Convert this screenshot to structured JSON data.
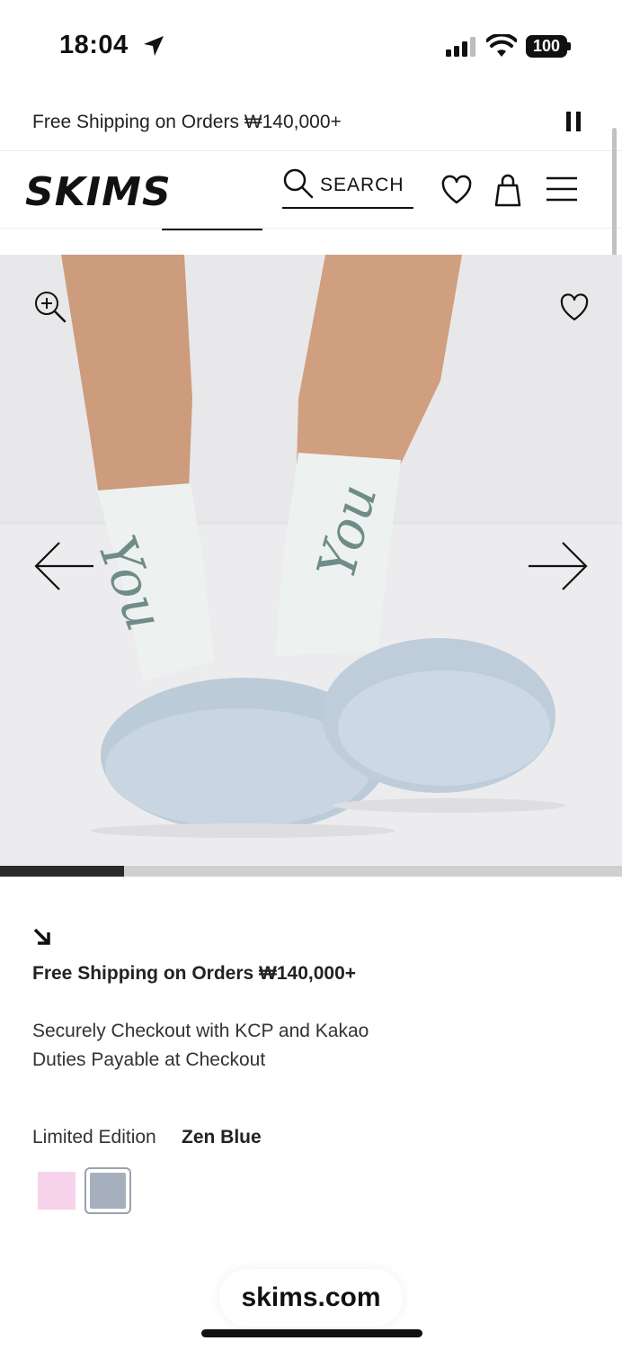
{
  "status_bar": {
    "time": "18:04",
    "battery": "100",
    "icons": [
      "location-arrow-icon",
      "signal-icon",
      "wifi-icon",
      "battery-icon"
    ]
  },
  "announcement": {
    "text": "Free Shipping on Orders ₩140,000+",
    "pause_icon": "pause-icon"
  },
  "header": {
    "logo": "SKIMS",
    "search_label": "SEARCH",
    "icons": [
      "search-icon",
      "heart-icon",
      "bag-icon",
      "menu-icon"
    ]
  },
  "gallery": {
    "image_alt": "Socks with fuzzy slippers",
    "sock_script": "You",
    "progress_fraction": 0.2,
    "colors": {
      "background": "#ececee",
      "slipper": "#c3cfdb",
      "sock": "#edf2f0"
    }
  },
  "product_info": {
    "shipping_title": "Free Shipping on Orders ₩140,000+",
    "checkout_line_1": "Securely Checkout with KCP and Kakao",
    "checkout_line_2": "Duties Payable at Checkout",
    "color_label": "Limited Edition",
    "selected_color": "Zen Blue",
    "swatches": [
      {
        "color": "#f6d3ea",
        "selected": false
      },
      {
        "color": "#a5afbd",
        "selected": true
      }
    ]
  },
  "browser": {
    "url": "skims.com"
  }
}
